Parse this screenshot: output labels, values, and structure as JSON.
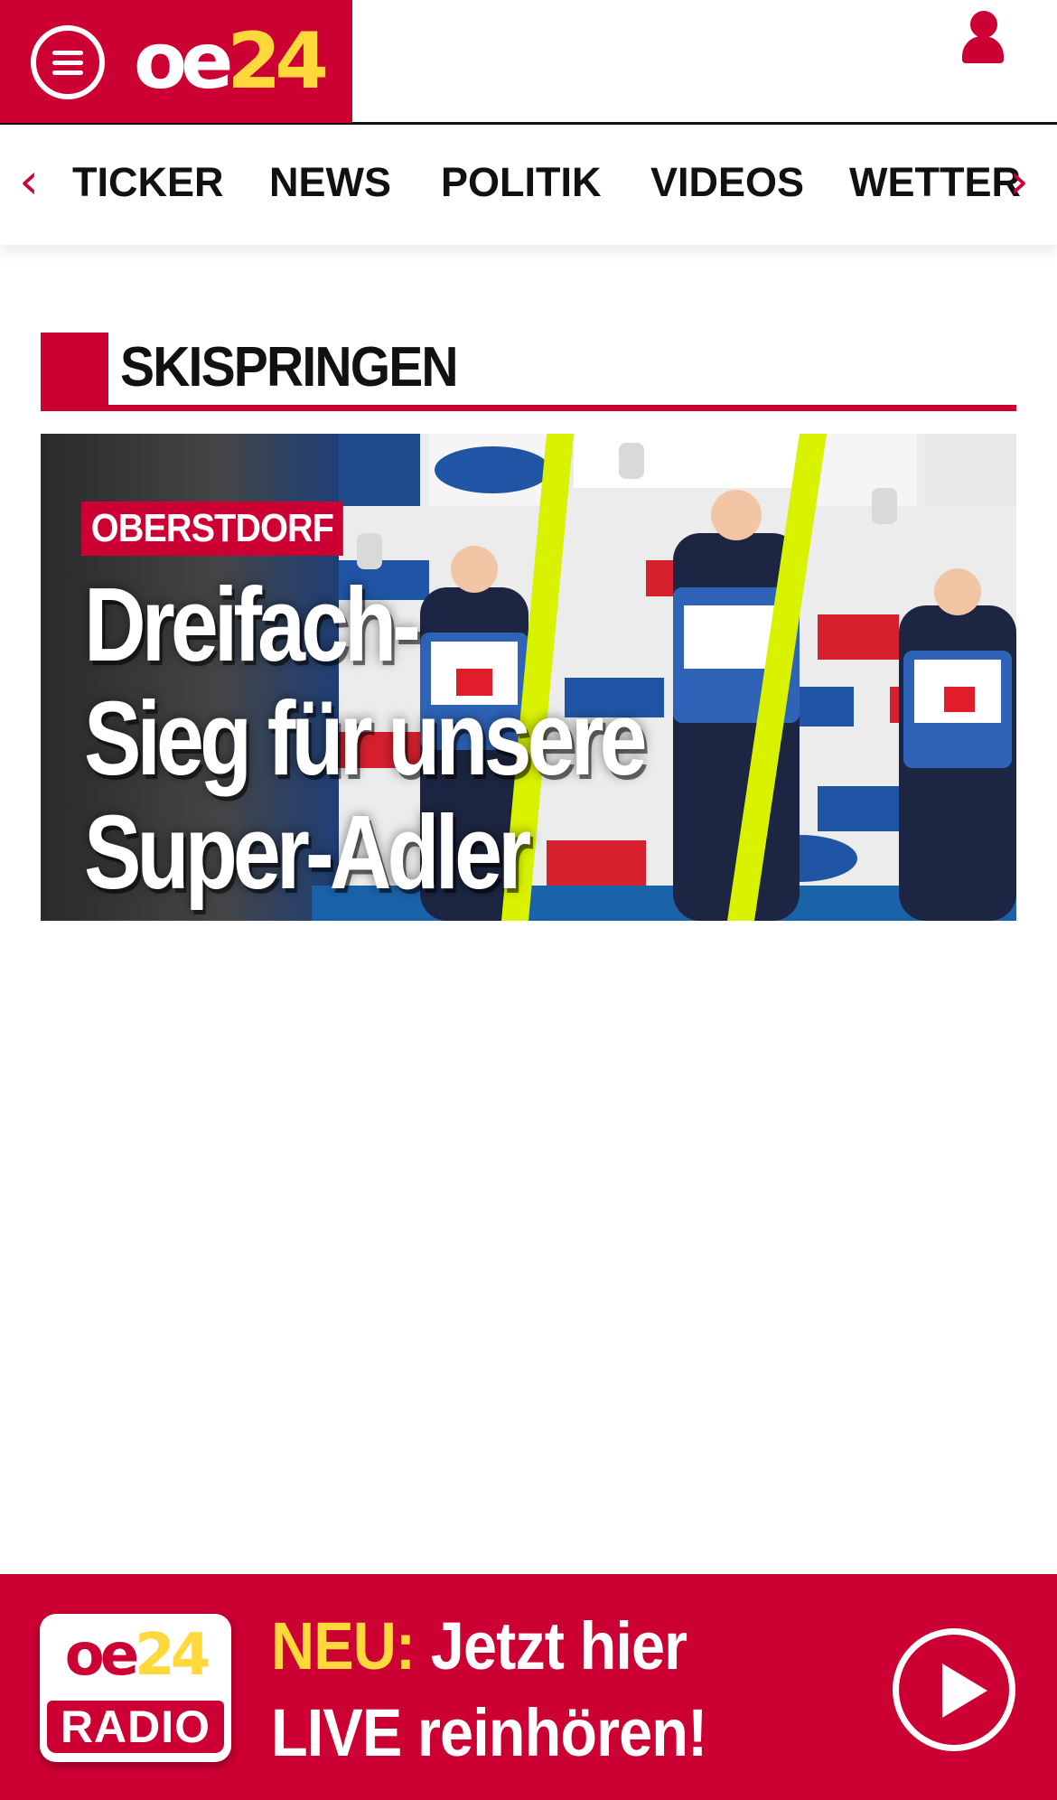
{
  "header": {
    "logo_oe": "oe",
    "logo_num": "24",
    "menu_icon": "hamburger-menu-icon",
    "user_icon": "user-icon",
    "brand_color": "#cc0033",
    "logo_accent_color": "#ffd83b"
  },
  "nav": {
    "prev_icon": "chevron-left-icon",
    "next_icon": "chevron-right-icon",
    "prev_glyph": "‹",
    "next_glyph": "›",
    "items": [
      {
        "label": "TICKER"
      },
      {
        "label": "NEWS"
      },
      {
        "label": "POLITIK"
      },
      {
        "label": "VIDEOS"
      },
      {
        "label": "WETTER"
      }
    ]
  },
  "section": {
    "title": "SKISPRINGEN"
  },
  "teaser": {
    "kicker": "OBERSTDORF",
    "headline_lines": [
      "Dreifach-",
      "Sieg für unsere",
      "Super-Adler"
    ],
    "image_icon": "ski-jumping-podium-photo"
  },
  "radio": {
    "logo_oe": "oe",
    "logo_num": "24",
    "logo_word": "RADIO",
    "neu_label": "NEU:",
    "line1_rest": " Jetzt hier",
    "line2": "LIVE reinhören!",
    "play_icon": "play-icon"
  }
}
